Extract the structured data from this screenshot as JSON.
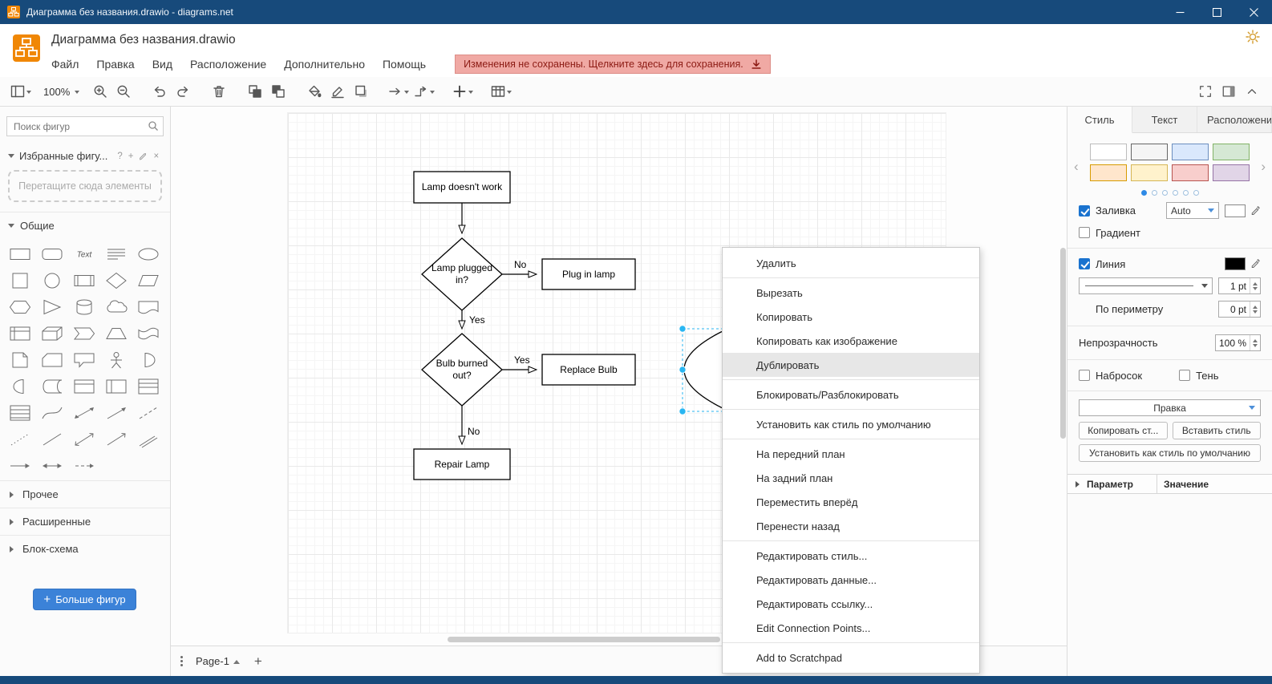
{
  "window": {
    "title": "Диаграмма без названия.drawio - diagrams.net"
  },
  "header": {
    "document_title": "Диаграмма без названия.drawio",
    "menus": [
      "Файл",
      "Правка",
      "Вид",
      "Расположение",
      "Дополнительно",
      "Помощь"
    ],
    "unsaved_banner": "Изменения не сохранены. Щелкните здесь для сохранения."
  },
  "toolbar": {
    "zoom_level": "100%"
  },
  "shapes_sidebar": {
    "search_placeholder": "Поиск фигур",
    "favorites_title": "Избранные фигу...",
    "favorites_help_icon": "?",
    "drop_hint": "Перетащите сюда элементы",
    "sections": [
      "Общие",
      "Прочее",
      "Расширенные",
      "Блок-схема"
    ],
    "more_shapes_label": "Больше фигур",
    "shape_icons": [
      "rectangle",
      "rounded-rectangle",
      "text",
      "textbox",
      "ellipse",
      "square",
      "circle",
      "process",
      "diamond",
      "parallelogram",
      "hexagon",
      "triangle",
      "cylinder",
      "cloud",
      "document",
      "internal-storage",
      "cube",
      "step",
      "trapezoid",
      "tape",
      "note",
      "card",
      "callout",
      "actor",
      "or",
      "and",
      "data-storage",
      "container",
      "vertical-container",
      "list",
      "list-item",
      "curve",
      "bidirectional-arrow",
      "arrow",
      "dashed-line",
      "dotted-line",
      "line",
      "bidirectional-connector",
      "directional-connector",
      "link",
      "thin-arrow",
      "double-arrow",
      "dashed-arrow"
    ]
  },
  "canvas": {
    "nodes": {
      "start": "Lamp doesn't work",
      "decision1": "Lamp plugged in?",
      "plug": "Plug in lamp",
      "decision2": "Bulb burned out?",
      "replace": "Replace Bulb",
      "repair": "Repair Lamp"
    },
    "edge_labels": {
      "no1": "No",
      "yes1": "Yes",
      "yes2": "Yes",
      "no2": "No"
    }
  },
  "context_menu": {
    "items": [
      "Удалить",
      "Вырезать",
      "Копировать",
      "Копировать как изображение",
      "Дублировать",
      "Блокировать/Разблокировать",
      "Установить как стиль по умолчанию",
      "На передний план",
      "На задний план",
      "Переместить вперёд",
      "Перенести назад",
      "Редактировать стиль...",
      "Редактировать данные...",
      "Редактировать ссылку...",
      "Edit Connection Points...",
      "Add to Scratchpad"
    ],
    "highlighted_item": "Дублировать"
  },
  "format_panel": {
    "tabs": [
      "Стиль",
      "Текст",
      "Расположение"
    ],
    "active_tab": "Стиль",
    "style_presets": [
      {
        "fill": "#ffffff",
        "stroke": "#bcbcbc"
      },
      {
        "fill": "#f5f5f5",
        "stroke": "#666666"
      },
      {
        "fill": "#dae8fc",
        "stroke": "#6c8ebf"
      },
      {
        "fill": "#d5e8d4",
        "stroke": "#82b366"
      },
      {
        "fill": "#ffe6cc",
        "stroke": "#d79b00"
      },
      {
        "fill": "#fff2cc",
        "stroke": "#d6b656"
      },
      {
        "fill": "#f8cecc",
        "stroke": "#b85450"
      },
      {
        "fill": "#e1d5e7",
        "stroke": "#9673a6"
      }
    ],
    "fill_label": "Заливка",
    "fill_mode": "Auto",
    "gradient_label": "Градиент",
    "line_label": "Линия",
    "line_width": "1 pt",
    "perimeter_label": "По периметру",
    "perimeter_value": "0 pt",
    "opacity_label": "Непрозрачность",
    "opacity_value": "100 %",
    "sketch_label": "Набросок",
    "shadow_label": "Тень",
    "edit_select_label": "Правка",
    "copy_style_label": "Копировать ст...",
    "paste_style_label": "Вставить стиль",
    "set_default_style_label": "Установить как стиль по умолчанию",
    "property_column": "Параметр",
    "value_column": "Значение"
  },
  "footer": {
    "page_tab": "Page-1"
  },
  "colors": {
    "titlebar": "#174a7b",
    "accent_blue": "#3b82d8",
    "selection_cyan": "#29b6f2",
    "logo_orange": "#f08705",
    "banner_bg": "#f0a9a4",
    "banner_text": "#8c1a13"
  }
}
